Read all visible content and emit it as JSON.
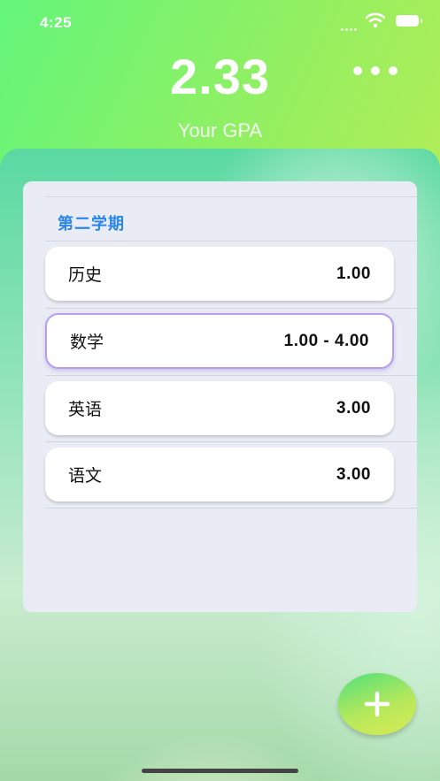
{
  "status_bar": {
    "time": "4:25"
  },
  "header": {
    "gpa_value": "2.33",
    "gpa_label": "Your GPA"
  },
  "semester": {
    "title": "第二学期",
    "courses": [
      {
        "name": "历史",
        "grade": "1.00"
      },
      {
        "name": "数学",
        "grade": "1.00 - 4.00"
      },
      {
        "name": "英语",
        "grade": "3.00"
      },
      {
        "name": "语文",
        "grade": "3.00"
      }
    ]
  },
  "icons": {
    "more": "more-dots-icon",
    "add": "plus-icon"
  },
  "colors": {
    "accent_blue": "#2b86e8",
    "selected_border": "#b79cf0",
    "gradient_start": "#63f57a",
    "gradient_end": "#d8ea4f"
  }
}
